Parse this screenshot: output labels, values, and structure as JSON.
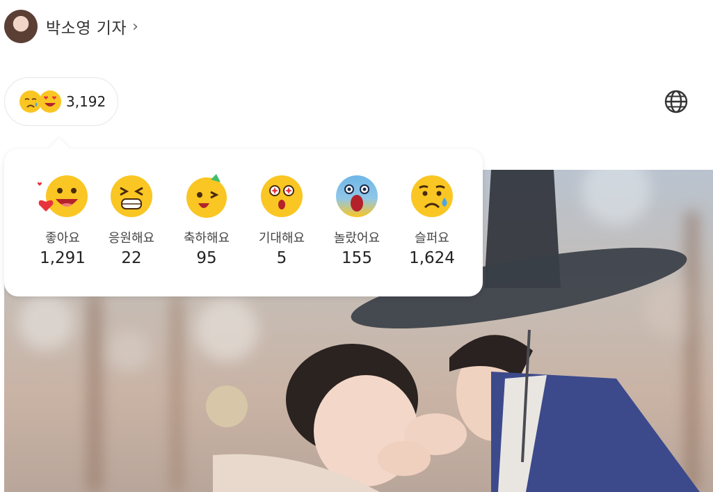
{
  "author": {
    "name": "박소영 기자",
    "chevron": "›"
  },
  "reaction_summary": {
    "total": "3,192",
    "icons": [
      "sad-face-icon",
      "heart-eyes-face-icon"
    ]
  },
  "reactions": [
    {
      "label": "좋아요",
      "count": "1,291",
      "icon": "like-face-icon"
    },
    {
      "label": "응원해요",
      "count": "22",
      "icon": "cheer-face-icon"
    },
    {
      "label": "축하해요",
      "count": "95",
      "icon": "celebrate-face-icon"
    },
    {
      "label": "기대해요",
      "count": "5",
      "icon": "expect-face-icon"
    },
    {
      "label": "놀랐어요",
      "count": "155",
      "icon": "surprised-face-icon"
    },
    {
      "label": "슬퍼요",
      "count": "1,624",
      "icon": "sad-face-icon"
    }
  ],
  "colors": {
    "emoji_yellow": "#f9c623",
    "emoji_blue": "#6fb6e6",
    "heart_red": "#e8333d"
  }
}
